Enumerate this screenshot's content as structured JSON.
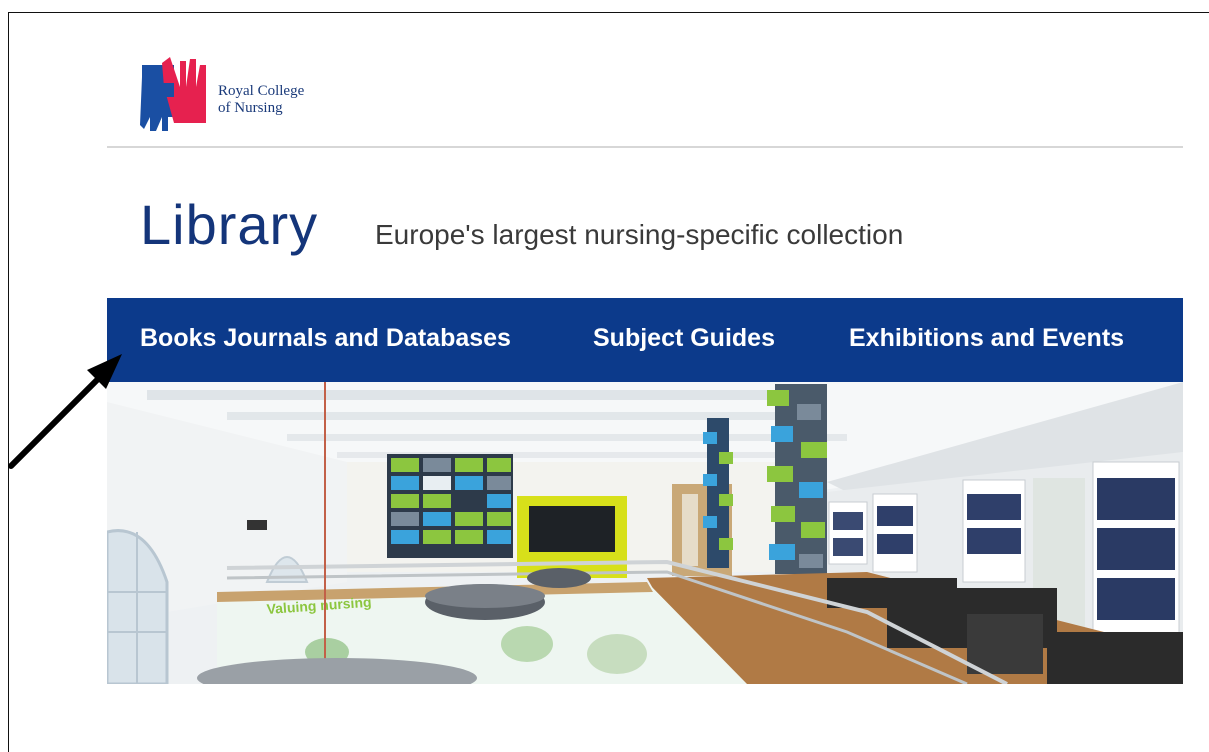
{
  "logo": {
    "line1": "Royal College",
    "line2": "of Nursing",
    "colors": {
      "blue": "#1a4fa3",
      "pink": "#e6214f"
    }
  },
  "header": {
    "title": "Library",
    "subtitle": "Europe's largest nursing-specific collection"
  },
  "nav": {
    "items": [
      {
        "label": "Books Journals and Databases"
      },
      {
        "label": "Subject Guides"
      },
      {
        "label": "Exhibitions and Events"
      }
    ],
    "color": "#0c3a8b"
  },
  "hero": {
    "wall_text": "Valuing nursing"
  },
  "annotation": {
    "icon": "arrow-icon",
    "color": "#000000"
  }
}
